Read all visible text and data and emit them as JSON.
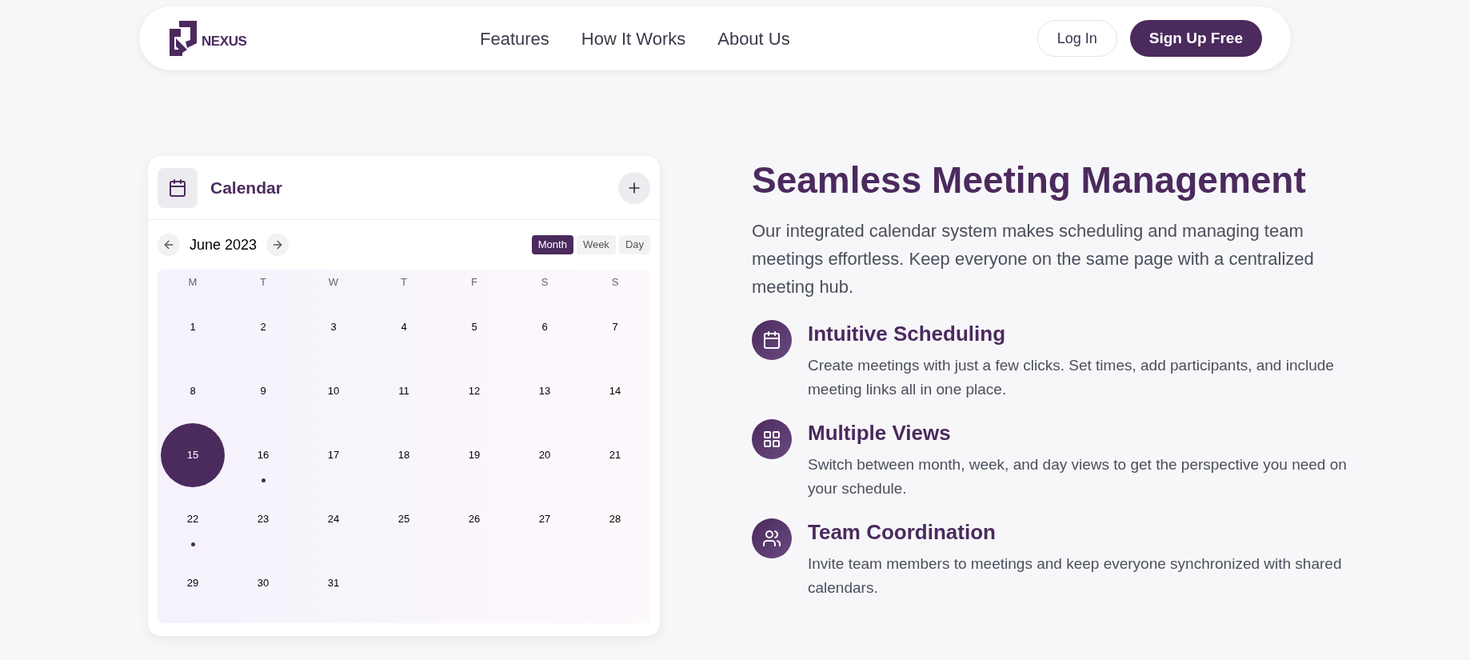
{
  "nav": {
    "logo": "NEXUS",
    "links": [
      "Features",
      "How It Works",
      "About Us"
    ],
    "login": "Log In",
    "signup": "Sign Up Free"
  },
  "calendar": {
    "title": "Calendar",
    "month": "June 2023",
    "views": [
      {
        "label": "Month",
        "selected": true
      },
      {
        "label": "Week",
        "selected": false
      },
      {
        "label": "Day",
        "selected": false
      }
    ],
    "weekdays": [
      "M",
      "T",
      "W",
      "T",
      "F",
      "S",
      "S"
    ],
    "days": [
      {
        "label": "1",
        "selected": false,
        "has_event": false
      },
      {
        "label": "2",
        "selected": false,
        "has_event": false
      },
      {
        "label": "3",
        "selected": false,
        "has_event": false
      },
      {
        "label": "4",
        "selected": false,
        "has_event": false
      },
      {
        "label": "5",
        "selected": false,
        "has_event": false
      },
      {
        "label": "6",
        "selected": false,
        "has_event": false
      },
      {
        "label": "7",
        "selected": false,
        "has_event": false
      },
      {
        "label": "8",
        "selected": false,
        "has_event": false
      },
      {
        "label": "9",
        "selected": false,
        "has_event": false
      },
      {
        "label": "10",
        "selected": false,
        "has_event": false
      },
      {
        "label": "11",
        "selected": false,
        "has_event": false
      },
      {
        "label": "12",
        "selected": false,
        "has_event": false
      },
      {
        "label": "13",
        "selected": false,
        "has_event": false
      },
      {
        "label": "14",
        "selected": false,
        "has_event": false
      },
      {
        "label": "15",
        "selected": true,
        "has_event": false
      },
      {
        "label": "16",
        "selected": false,
        "has_event": true
      },
      {
        "label": "17",
        "selected": false,
        "has_event": false
      },
      {
        "label": "18",
        "selected": false,
        "has_event": false
      },
      {
        "label": "19",
        "selected": false,
        "has_event": false
      },
      {
        "label": "20",
        "selected": false,
        "has_event": false
      },
      {
        "label": "21",
        "selected": false,
        "has_event": false
      },
      {
        "label": "22",
        "selected": false,
        "has_event": true
      },
      {
        "label": "23",
        "selected": false,
        "has_event": false
      },
      {
        "label": "24",
        "selected": false,
        "has_event": false
      },
      {
        "label": "25",
        "selected": false,
        "has_event": false
      },
      {
        "label": "26",
        "selected": false,
        "has_event": false
      },
      {
        "label": "27",
        "selected": false,
        "has_event": false
      },
      {
        "label": "28",
        "selected": false,
        "has_event": false
      },
      {
        "label": "29",
        "selected": false,
        "has_event": false
      },
      {
        "label": "30",
        "selected": false,
        "has_event": false
      },
      {
        "label": "31",
        "selected": false,
        "has_event": false
      }
    ]
  },
  "section": {
    "heading": "Seamless Meeting Management",
    "intro": "Our integrated calendar system makes scheduling and managing team meetings effortless. Keep everyone on the same page with a centralized meeting hub.",
    "features": [
      {
        "kind": "calendar",
        "title": "Intuitive Scheduling",
        "text": "Create meetings with just a few clicks. Set times, add participants, and include meeting links all in one place."
      },
      {
        "kind": "grid",
        "title": "Multiple Views",
        "text": "Switch between month, week, and day views to get the perspective you need on your schedule."
      },
      {
        "kind": "users",
        "title": "Team Coordination",
        "text": "Invite team members to meetings and keep everyone synchronized with shared calendars."
      }
    ]
  }
}
